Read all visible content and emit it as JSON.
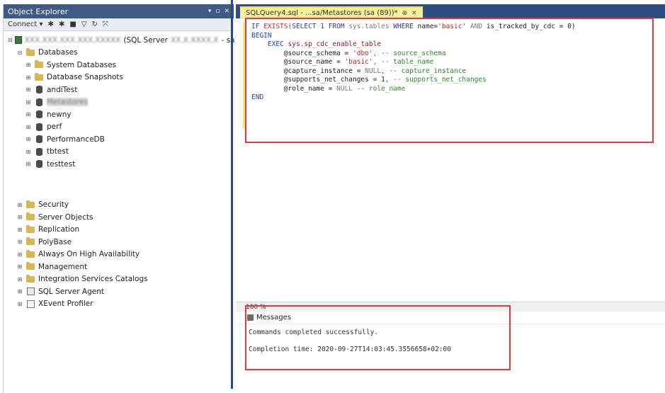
{
  "object_explorer": {
    "title": "Object Explorer",
    "title_icons": [
      "▾",
      "▫",
      "✕"
    ],
    "toolbar": {
      "connect": "Connect ▾",
      "btn_connect_obj": "✱",
      "btn_disconnect": "✱",
      "btn_stop": "■",
      "btn_filter": "▽",
      "btn_refresh": "↻",
      "btn_collapse": "⤧"
    },
    "server_node": {
      "name": "XXX.XXX.XXX.XXX,XXXXX",
      "suffix": "(SQL Server",
      "version": "XX.X.XXXX.X",
      "login": "- sa)"
    },
    "databases_label": "Databases",
    "database_children": [
      {
        "label": "System Databases",
        "type": "folder"
      },
      {
        "label": "Database Snapshots",
        "type": "folder"
      },
      {
        "label": "andiTest",
        "type": "db"
      },
      {
        "label": "Metastores",
        "type": "db",
        "selected": true
      },
      {
        "label": "newny",
        "type": "db"
      },
      {
        "label": "perf",
        "type": "db"
      },
      {
        "label": "PerformanceDB",
        "type": "db"
      },
      {
        "label": "tbtest",
        "type": "db"
      },
      {
        "label": "testtest",
        "type": "db"
      }
    ],
    "server_children": [
      {
        "label": "Security",
        "type": "folder"
      },
      {
        "label": "Server Objects",
        "type": "folder"
      },
      {
        "label": "Replication",
        "type": "folder"
      },
      {
        "label": "PolyBase",
        "type": "folder"
      },
      {
        "label": "Always On High Availability",
        "type": "folder"
      },
      {
        "label": "Management",
        "type": "folder"
      },
      {
        "label": "Integration Services Catalogs",
        "type": "folder"
      },
      {
        "label": "SQL Server Agent",
        "type": "agent"
      },
      {
        "label": "XEvent Profiler",
        "type": "profiler"
      }
    ]
  },
  "editor": {
    "tab_label": "SQLQuery4.sql - ...sa/Metastores (sa (89))*",
    "tab_pin": "⊕",
    "tab_close": "✕",
    "code": {
      "l1_kw": "IF",
      "l1_fn": " EXISTS(",
      "l1_sel": "SELECT 1 FROM",
      "l1_obj": " sys.tables ",
      "l1_where": "WHERE",
      "l1_name": " name=",
      "l1_str": "'basic'",
      "l1_and": " AND",
      "l1_rest": " is_tracked_by_cdc = 0)",
      "l2": "BEGIN",
      "l3_kw": "EXEC",
      "l3_rest": " sys.sp_cdc_enable_table",
      "l4_param": "@source_schema = ",
      "l4_str": "'dbo'",
      "l4_cm": ", -- source_schema",
      "l5_param": "@source_name = ",
      "l5_str": "'basic'",
      "l5_cm": ", -- table_name",
      "l6_param": "@capture_instance = ",
      "l6_null": "NULL",
      "l6_cm": ", -- capture_instance",
      "l7_param": "@supports_net_changes = 1",
      "l7_cm": ", -- supports_net_changes",
      "l8_param": "@role_name = ",
      "l8_null": "NULL",
      "l8_cm": " -- role_name",
      "l9": "END"
    }
  },
  "results": {
    "zoom": "100 %",
    "messages_tab": "Messages",
    "line1": "Commands completed successfully.",
    "line2": "Completion time: 2020-09-27T14:03:45.3556658+02:00"
  }
}
